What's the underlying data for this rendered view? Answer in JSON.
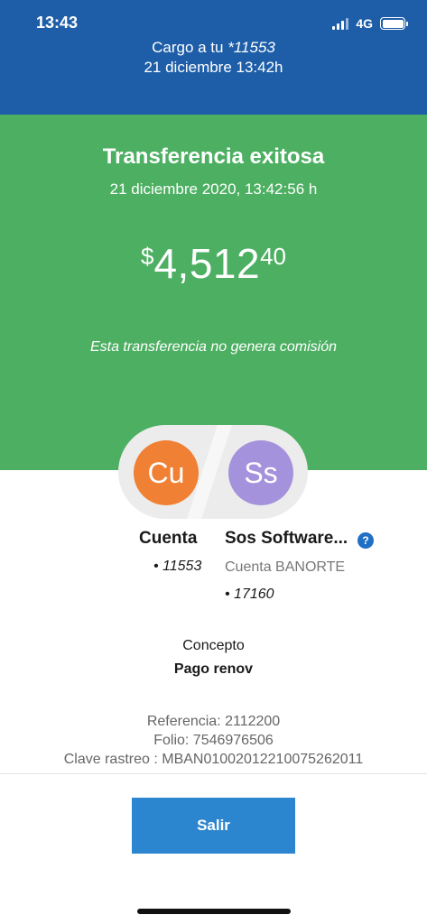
{
  "status_bar": {
    "time": "13:43",
    "network": "4G",
    "battery_level": 1.0
  },
  "header": {
    "charge_prefix": "Cargo a tu",
    "account": "*11553",
    "date": "21 diciembre 13:42h"
  },
  "success": {
    "title": "Transferencia exitosa",
    "datetime": "21 diciembre 2020, 13:42:56 h",
    "currency_symbol": "$",
    "amount_integer": "4,512",
    "amount_cents": "40",
    "fee_note": "Esta transferencia no genera comisión"
  },
  "from": {
    "initials": "Cu",
    "name": "Cuenta",
    "account": "• 11553",
    "color": "#f08033"
  },
  "to": {
    "initials": "Ss",
    "name": "Sos Software...",
    "bank": "Cuenta BANORTE",
    "account": "• 17160",
    "help_glyph": "?",
    "color": "#a592dc"
  },
  "concept": {
    "label": "Concepto",
    "value": "Pago renov"
  },
  "details": {
    "reference": "Referencia: 2112200",
    "folio": "Folio: 7546976506",
    "tracking_key": "Clave rastreo : MBAN01002012210075262011"
  },
  "actions": {
    "exit_label": "Salir"
  },
  "colors": {
    "header": "#1e5ea8",
    "success": "#4daf62",
    "button": "#2c86cf"
  }
}
